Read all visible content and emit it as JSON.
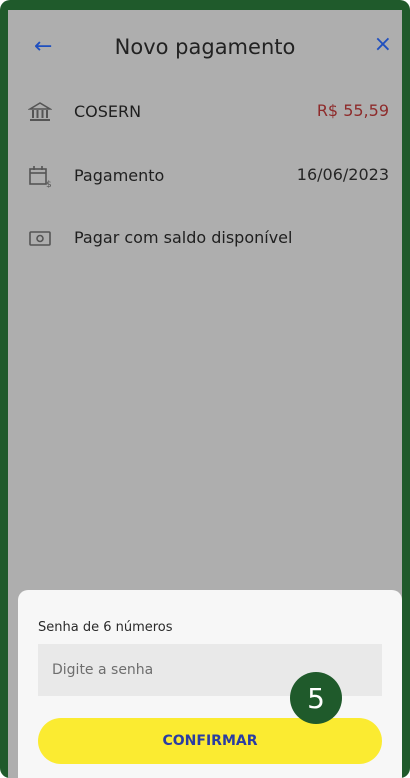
{
  "header": {
    "back_icon": "←",
    "title": "Novo pagamento",
    "close_icon": "×"
  },
  "rows": [
    {
      "icon": "bank-icon",
      "label": "COSERN",
      "value": "R$ 55,59",
      "value_color": "#8e2b2b"
    },
    {
      "icon": "calendar-money-icon",
      "label": "Pagamento",
      "value": "16/06/2023"
    },
    {
      "icon": "wallet-icon",
      "label": "Pagar com saldo disponível"
    }
  ],
  "sheet": {
    "label": "Senha de 6 números",
    "password_placeholder": "Digite a senha",
    "confirm_label": "CONFIRMAR"
  },
  "badge": {
    "number": "5"
  },
  "colors": {
    "frame": "#1f5a2b",
    "overlay": "#aeaeae",
    "accent_blue": "#1f4fbf",
    "button_yellow": "#fbeb31",
    "button_text": "#2a3da2"
  }
}
